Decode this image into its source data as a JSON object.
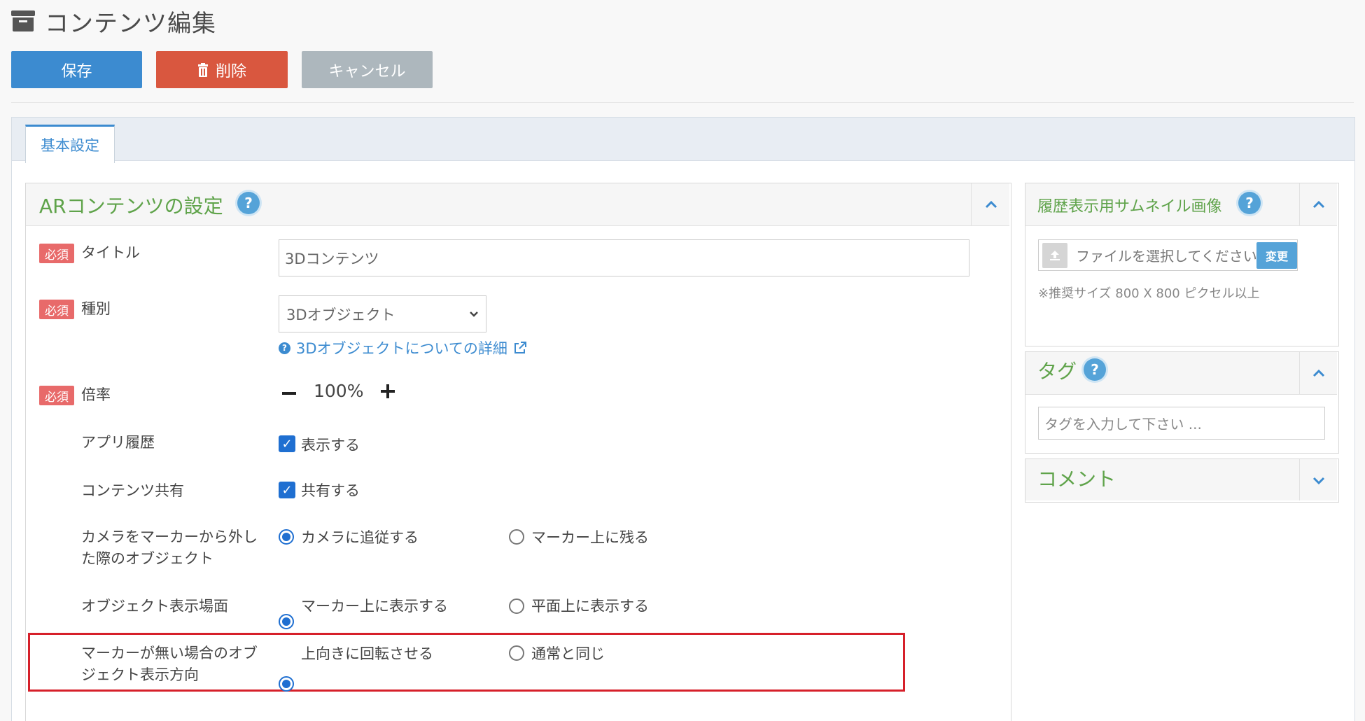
{
  "header": {
    "title": "コンテンツ編集",
    "save_label": "保存",
    "delete_label": "削除",
    "cancel_label": "キャンセル"
  },
  "tabs": [
    {
      "label": "基本設定",
      "active": true
    }
  ],
  "ar_settings": {
    "title": "ARコンテンツの設定",
    "required_badge": "必須",
    "fields": {
      "title": {
        "label": "タイトル",
        "value": "3Dコンテンツ"
      },
      "type": {
        "label": "種別",
        "value": "3Dオブジェクト",
        "help_link": "3Dオブジェクトについての詳細"
      },
      "scale": {
        "label": "倍率",
        "value": "100%"
      },
      "app_history": {
        "label": "アプリ履歴",
        "option": "表示する",
        "checked": true
      },
      "content_share": {
        "label": "コンテンツ共有",
        "option": "共有する",
        "checked": true
      },
      "camera_off_marker": {
        "label_line1": "カメラをマーカーから外し",
        "label_line2": "た際のオブジェクト",
        "options": [
          "カメラに追従する",
          "マーカー上に残る"
        ],
        "selected": 0
      },
      "display_scene": {
        "label": "オブジェクト表示場面",
        "options": [
          "マーカー上に表示する",
          "平面上に表示する"
        ],
        "selected": 0
      },
      "no_marker_direction": {
        "label_line1": "マーカーが無い場合のオブ",
        "label_line2": "ジェクト表示方向",
        "options": [
          "上向きに回転させる",
          "通常と同じ"
        ],
        "selected": 0
      }
    }
  },
  "thumbnail": {
    "title": "履歴表示用サムネイル画像",
    "file_placeholder": "ファイルを選択してください",
    "change_label": "変更",
    "note": "※推奨サイズ 800 X 800 ピクセル以上"
  },
  "tags": {
    "title": "タグ",
    "placeholder": "タグを入力して下さい ..."
  },
  "comment": {
    "title": "コメント"
  },
  "colors": {
    "primary": "#3c8bd0",
    "danger": "#d9573f",
    "muted": "#adb7bd",
    "panel_title": "#5fa34a",
    "required": "#e86a6a",
    "highlight": "#d6202a"
  }
}
